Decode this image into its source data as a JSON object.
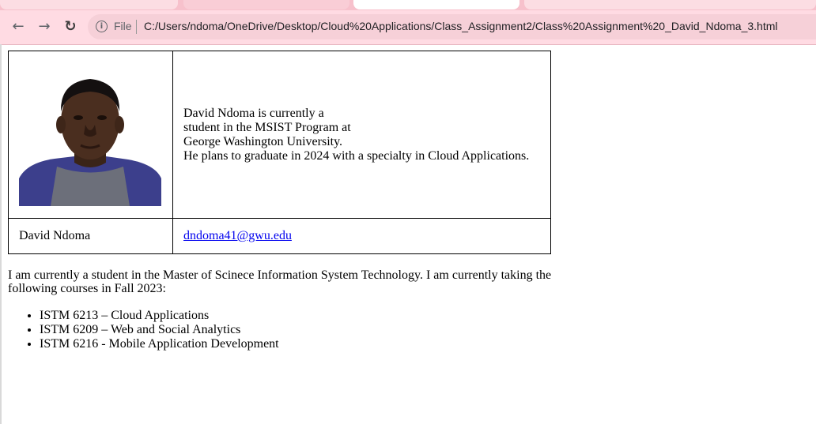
{
  "browser": {
    "file_label": "File",
    "url": "C:/Users/ndoma/OneDrive/Desktop/Cloud%20Applications/Class_Assignment2/Class%20Assignment%20_David_Ndoma_3.html"
  },
  "profile": {
    "bio_lines": [
      "David Ndoma is currently a",
      "student in the MSIST Program at",
      "George Washington University.",
      "He plans to graduate in 2024 with a specialty in Cloud Applications."
    ],
    "name": "David Ndoma",
    "email": "dndoma41@gwu.edu"
  },
  "intro": "I am currently a student in the Master of Scinece Information System Technology. I am currently taking the following courses in Fall 2023:",
  "courses": [
    "ISTM 6213 – Cloud Applications",
    "ISTM 6209 – Web and Social Analytics",
    "ISTM 6216 - Mobile Application Development"
  ]
}
